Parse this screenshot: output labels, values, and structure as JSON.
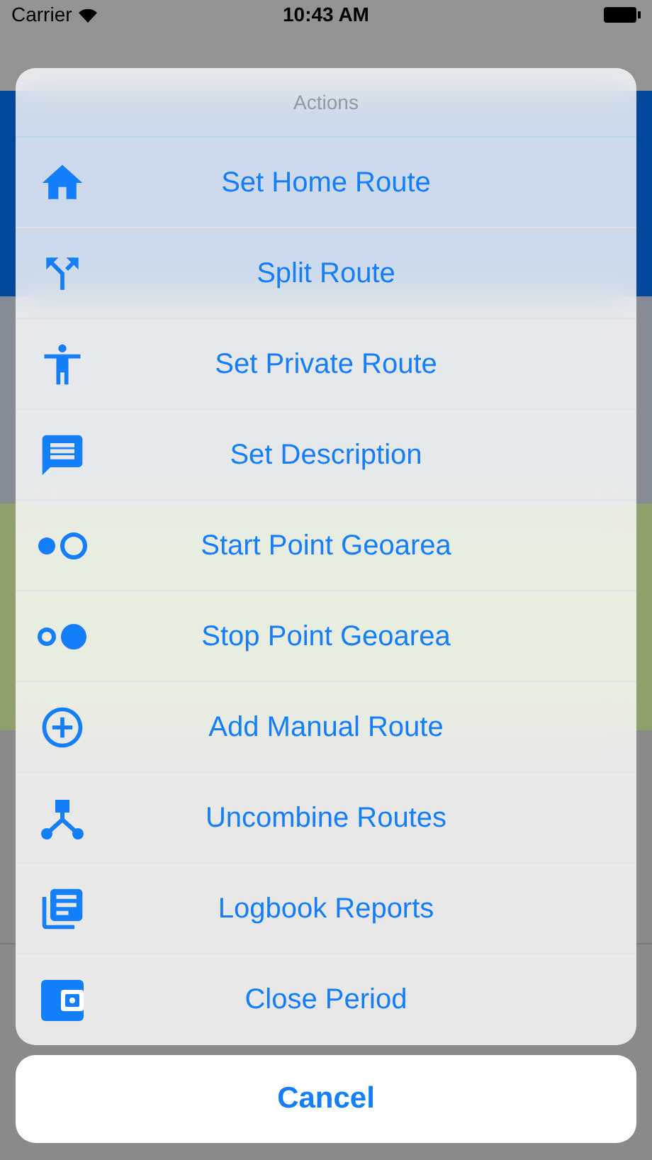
{
  "status_bar": {
    "carrier": "Carrier",
    "time": "10:43 AM"
  },
  "action_sheet": {
    "title": "Actions",
    "actions": [
      {
        "label": "Set Home Route"
      },
      {
        "label": "Split Route"
      },
      {
        "label": "Set Private Route"
      },
      {
        "label": "Set Description"
      },
      {
        "label": "Start Point Geoarea"
      },
      {
        "label": "Stop Point Geoarea"
      },
      {
        "label": "Add Manual Route"
      },
      {
        "label": "Uncombine Routes"
      },
      {
        "label": "Logbook Reports"
      },
      {
        "label": "Close Period"
      }
    ],
    "cancel": "Cancel"
  }
}
